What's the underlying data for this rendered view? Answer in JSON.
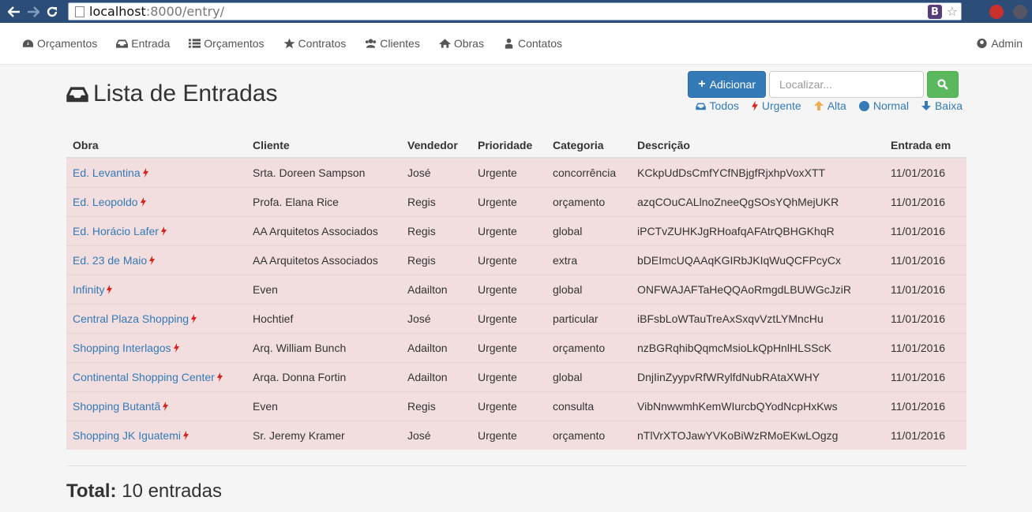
{
  "browser": {
    "url_host": "localhost",
    "url_rest": ":8000/entry/",
    "ext_label": "B"
  },
  "nav": {
    "items": [
      {
        "label": "Orçamentos",
        "icon": "dashboard-icon"
      },
      {
        "label": "Entrada",
        "icon": "inbox-icon"
      },
      {
        "label": "Orçamentos",
        "icon": "list-icon"
      },
      {
        "label": "Contratos",
        "icon": "star-icon"
      },
      {
        "label": "Clientes",
        "icon": "users-icon"
      },
      {
        "label": "Obras",
        "icon": "home-icon"
      },
      {
        "label": "Contatos",
        "icon": "user-icon"
      }
    ],
    "admin_label": "Admin"
  },
  "page": {
    "title": "Lista de Entradas",
    "add_label": "Adicionar",
    "search_placeholder": "Localizar...",
    "filters": [
      {
        "label": "Todos",
        "icon": "inbox-icon",
        "color": "#337ab7"
      },
      {
        "label": "Urgente",
        "icon": "bolt-icon",
        "color": "#d9231d"
      },
      {
        "label": "Alta",
        "icon": "arrow-up-icon",
        "color": "#f0ad4e"
      },
      {
        "label": "Normal",
        "icon": "circle-icon",
        "color": "#337ab7"
      },
      {
        "label": "Baixa",
        "icon": "arrow-down-icon",
        "color": "#337ab7"
      }
    ]
  },
  "table": {
    "headers": [
      "Obra",
      "Cliente",
      "Vendedor",
      "Prioridade",
      "Categoria",
      "Descrição",
      "Entrada em"
    ],
    "rows": [
      {
        "obra": "Ed. Levantina",
        "cliente": "Srta. Doreen Sampson",
        "vendedor": "José",
        "prioridade": "Urgente",
        "categoria": "concorrência",
        "descricao": "KCkpUdDsCmfYCfNBjgfRjxhpVoxXTT",
        "data": "11/01/2016"
      },
      {
        "obra": "Ed. Leopoldo",
        "cliente": "Profa. Elana Rice",
        "vendedor": "Regis",
        "prioridade": "Urgente",
        "categoria": "orçamento",
        "descricao": "azqCOuCALlnoZneeQgSOsYQhMejUKR",
        "data": "11/01/2016"
      },
      {
        "obra": "Ed. Horácio Lafer",
        "cliente": "AA Arquitetos Associados",
        "vendedor": "Regis",
        "prioridade": "Urgente",
        "categoria": "global",
        "descricao": "iPCTvZUHKJgRHoafqAFAtrQBHGKhqR",
        "data": "11/01/2016"
      },
      {
        "obra": "Ed. 23 de Maio",
        "cliente": "AA Arquitetos Associados",
        "vendedor": "Regis",
        "prioridade": "Urgente",
        "categoria": "extra",
        "descricao": "bDEImcUQAAqKGIRbJKIqWuQCFPcyCx",
        "data": "11/01/2016"
      },
      {
        "obra": "Infinity",
        "cliente": "Even",
        "vendedor": "Adailton",
        "prioridade": "Urgente",
        "categoria": "global",
        "descricao": "ONFWAJAFTaHeQQAoRmgdLBUWGcJziR",
        "data": "11/01/2016"
      },
      {
        "obra": "Central Plaza Shopping",
        "cliente": "Hochtief",
        "vendedor": "José",
        "prioridade": "Urgente",
        "categoria": "particular",
        "descricao": "iBFsbLoWTauTreAxSxqvVztLYMncHu",
        "data": "11/01/2016"
      },
      {
        "obra": "Shopping Interlagos",
        "cliente": "Arq. William Bunch",
        "vendedor": "Adailton",
        "prioridade": "Urgente",
        "categoria": "orçamento",
        "descricao": "nzBGRqhibQqmcMsioLkQpHnlHLSScK",
        "data": "11/01/2016"
      },
      {
        "obra": "Continental Shopping Center",
        "cliente": "Arqa. Donna Fortin",
        "vendedor": "Adailton",
        "prioridade": "Urgente",
        "categoria": "global",
        "descricao": "DnjIinZyypvRfWRylfdNubRAtaXWHY",
        "data": "11/01/2016"
      },
      {
        "obra": "Shopping Butantã",
        "cliente": "Even",
        "vendedor": "Regis",
        "prioridade": "Urgente",
        "categoria": "consulta",
        "descricao": "VibNnwwmhKemWIurcbQYodNcpHxKws",
        "data": "11/01/2016"
      },
      {
        "obra": "Shopping JK Iguatemi",
        "cliente": "Sr. Jeremy Kramer",
        "vendedor": "José",
        "prioridade": "Urgente",
        "categoria": "orçamento",
        "descricao": "nTlVrXTOJawYVKoBiWzRMoEKwLOgzg",
        "data": "11/01/2016"
      }
    ]
  },
  "footer": {
    "total_label": "Total:",
    "total_value": "10 entradas"
  }
}
